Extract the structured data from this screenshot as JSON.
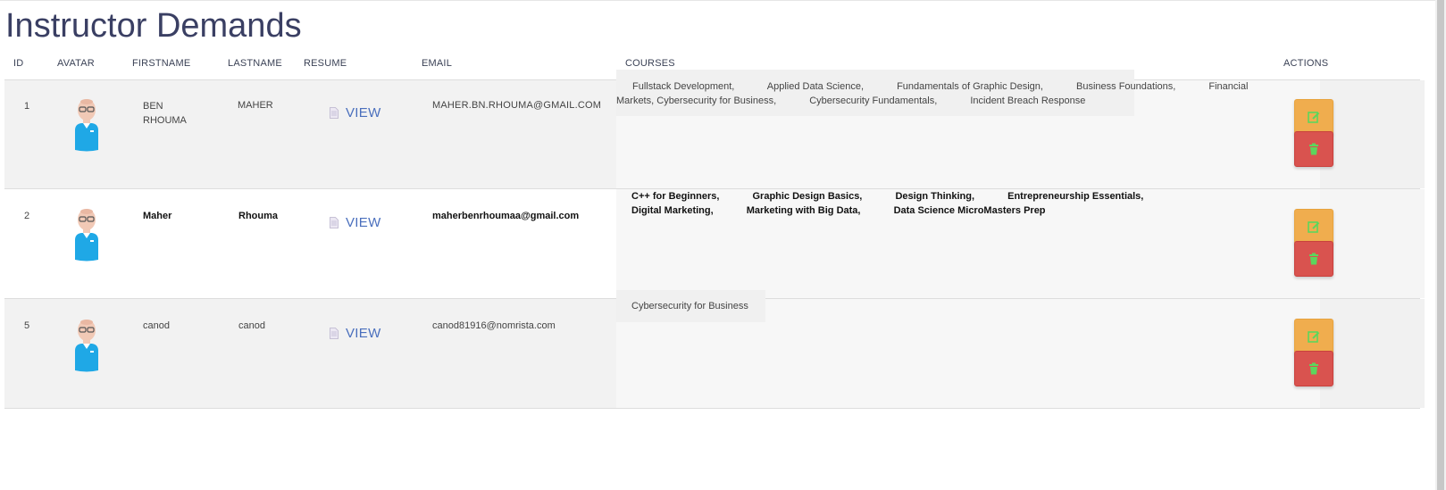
{
  "page": {
    "title": "Instructor Demands"
  },
  "table": {
    "headers": {
      "id": "ID",
      "avatar": "AVATAR",
      "firstname": "FIRSTNAME",
      "lastname": "LASTNAME",
      "resume": "RESUME",
      "email": "EMAIL",
      "courses": "COURSES",
      "actions": "ACTIONS"
    },
    "rows": [
      {
        "id": "1",
        "firstname": "BEN RHOUMA",
        "lastname": "MAHER",
        "resume_label": "VIEW",
        "email": "MAHER.BN.RHOUMA@GMAIL.COM",
        "courses": [
          "Fullstack Development,",
          "Applied Data Science,",
          "Fundamentals of Graphic Design,",
          "Business Foundations,",
          "Financial Markets,",
          "Cybersecurity for Business,",
          "Cybersecurity Fundamentals,",
          "Incident Breach Response"
        ]
      },
      {
        "id": "2",
        "firstname": "Maher",
        "lastname": "Rhouma",
        "resume_label": "VIEW",
        "email": "maherbenrhoumaa@gmail.com",
        "courses": [
          "C++ for Beginners,",
          "Graphic Design Basics,",
          "Design Thinking,",
          "Entrepreneurship Essentials,",
          "Digital Marketing,",
          "Marketing with Big Data,",
          "Data Science MicroMasters Prep"
        ]
      },
      {
        "id": "5",
        "firstname": "canod",
        "lastname": "canod",
        "resume_label": "VIEW",
        "email": "canod81916@nomrista.com",
        "courses": [
          "Cybersecurity for Business"
        ]
      }
    ]
  },
  "icons": {
    "avatar": "user-avatar-icon",
    "document": "document-icon",
    "edit": "edit-icon",
    "delete": "trash-icon"
  },
  "colors": {
    "title": "#3a3f63",
    "link": "#4a6fbd",
    "edit_button": "#f0ad4e",
    "delete_button": "#d9534f",
    "action_icon": "#5cd65c"
  }
}
